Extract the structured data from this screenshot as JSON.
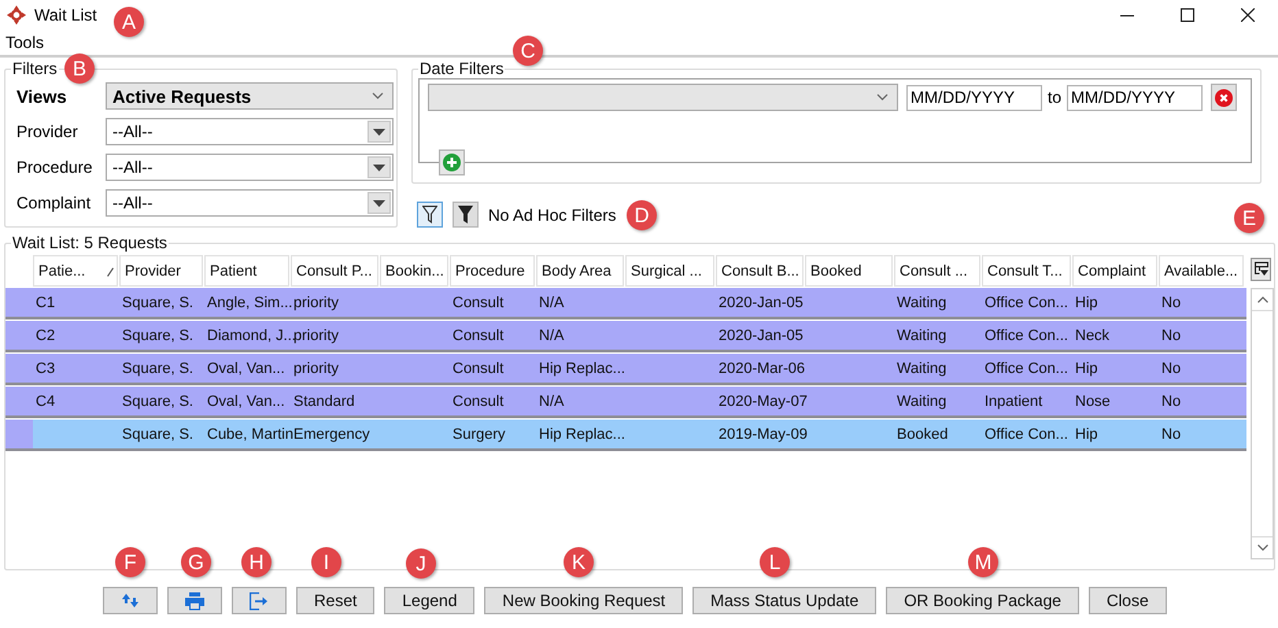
{
  "window": {
    "title": "Wait List"
  },
  "menu": [
    "Tools"
  ],
  "filters": {
    "title": "Filters",
    "views": {
      "label": "Views",
      "value": "Active Requests"
    },
    "fields": [
      {
        "label": "Provider",
        "value": "--All--"
      },
      {
        "label": "Procedure",
        "value": "--All--"
      },
      {
        "label": "Complaint",
        "value": "--All--"
      }
    ]
  },
  "date_filters": {
    "title": "Date Filters",
    "from": {
      "value": "MM/DD/YYYY"
    },
    "separator": "to",
    "to": {
      "value": "MM/DD/YYYY"
    }
  },
  "ad_hoc": {
    "buttons": [
      {
        "kind": "outline",
        "selected": true
      },
      {
        "kind": "filled",
        "selected": false
      }
    ],
    "text": "No Ad Hoc Filters"
  },
  "table": {
    "title": "Wait List: 5 Requests",
    "columns": [
      {
        "label": "Patie...",
        "sorted": true
      },
      {
        "label": "Provider",
        "sorted": false
      },
      {
        "label": "Patient",
        "sorted": false
      },
      {
        "label": "Consult P...",
        "sorted": false
      },
      {
        "label": "Bookin...",
        "sorted": false
      },
      {
        "label": "Procedure",
        "sorted": false
      },
      {
        "label": "Body Area",
        "sorted": false
      },
      {
        "label": "Surgical ...",
        "sorted": false
      },
      {
        "label": "Consult B...",
        "sorted": false
      },
      {
        "label": "Booked",
        "sorted": false
      },
      {
        "label": "Consult ...",
        "sorted": false
      },
      {
        "label": "Consult T...",
        "sorted": false
      },
      {
        "label": "Complaint",
        "sorted": false
      },
      {
        "label": "Available...",
        "sorted": false
      }
    ],
    "rows": [
      {
        "selected": false,
        "cells": [
          "C1",
          "Square, S.",
          "Angle, Sim...",
          "priority",
          null,
          "Consult",
          "N/A",
          null,
          "2020-Jan-05",
          null,
          "Waiting",
          "Office Con...",
          "Hip",
          "No"
        ]
      },
      {
        "selected": false,
        "cells": [
          "C2",
          "Square, S.",
          "Diamond, J...",
          "priority",
          null,
          "Consult",
          "N/A",
          null,
          "2020-Jan-05",
          null,
          "Waiting",
          "Office Con...",
          "Neck",
          "No"
        ]
      },
      {
        "selected": false,
        "cells": [
          "C3",
          "Square, S.",
          "Oval, Van...",
          "priority",
          null,
          "Consult",
          "Hip Replac...",
          null,
          "2020-Mar-06",
          null,
          "Waiting",
          "Office Con...",
          "Hip",
          "No"
        ]
      },
      {
        "selected": false,
        "cells": [
          "C4",
          "Square, S.",
          "Oval, Van...",
          "Standard",
          null,
          "Consult",
          "N/A",
          null,
          "2020-May-07",
          null,
          "Waiting",
          "Inpatient",
          "Nose",
          "No"
        ]
      },
      {
        "selected": true,
        "cells": [
          null,
          "Square, S.",
          "Cube, Martin",
          "Emergency",
          null,
          "Surgery",
          "Hip Replac...",
          null,
          "2019-May-09",
          null,
          "Booked",
          "Office Con...",
          "Hip",
          "No"
        ]
      }
    ]
  },
  "actions": [
    {
      "kind": "sync"
    },
    {
      "kind": "print"
    },
    {
      "kind": "exit"
    },
    {
      "kind": "text",
      "label": "Reset"
    },
    {
      "kind": "text",
      "label": "Legend"
    },
    {
      "kind": "text",
      "label": "New Booking Request"
    },
    {
      "kind": "text",
      "label": "Mass Status Update"
    },
    {
      "kind": "text",
      "label": "OR Booking Package"
    },
    {
      "kind": "text",
      "label": "Close"
    }
  ],
  "callouts": [
    {
      "label": "A"
    },
    {
      "label": "B"
    },
    {
      "label": "C"
    },
    {
      "label": "D"
    },
    {
      "label": "E"
    },
    {
      "label": "F"
    },
    {
      "label": "G"
    },
    {
      "label": "H"
    },
    {
      "label": "I"
    },
    {
      "label": "J"
    },
    {
      "label": "K"
    },
    {
      "label": "L"
    },
    {
      "label": "M"
    }
  ]
}
